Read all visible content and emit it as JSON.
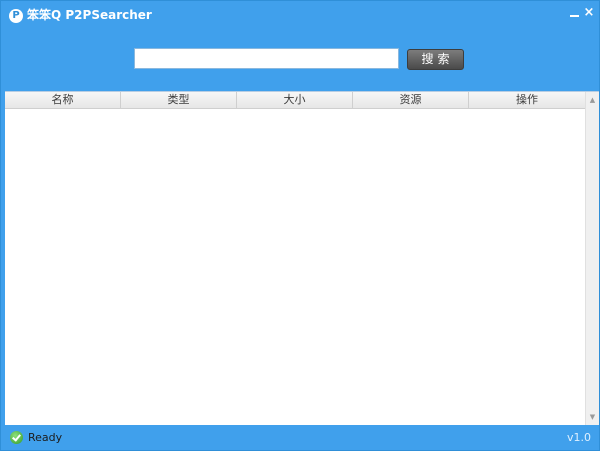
{
  "window": {
    "title": "笨笨Q P2PSearcher",
    "app_icon_letter": "P",
    "minimize_icon": "minimize-icon",
    "close_symbol": "×",
    "accent_color": "#40a0ec"
  },
  "search": {
    "value": "",
    "placeholder": "",
    "button_label": "搜索"
  },
  "table": {
    "columns": [
      "名称",
      "类型",
      "大小",
      "资源",
      "操作"
    ],
    "rows": []
  },
  "scrollbar": {
    "up_symbol": "▲",
    "down_symbol": "▼"
  },
  "status": {
    "icon": "check-circle-icon",
    "text": "Ready",
    "version": "v1.0"
  }
}
